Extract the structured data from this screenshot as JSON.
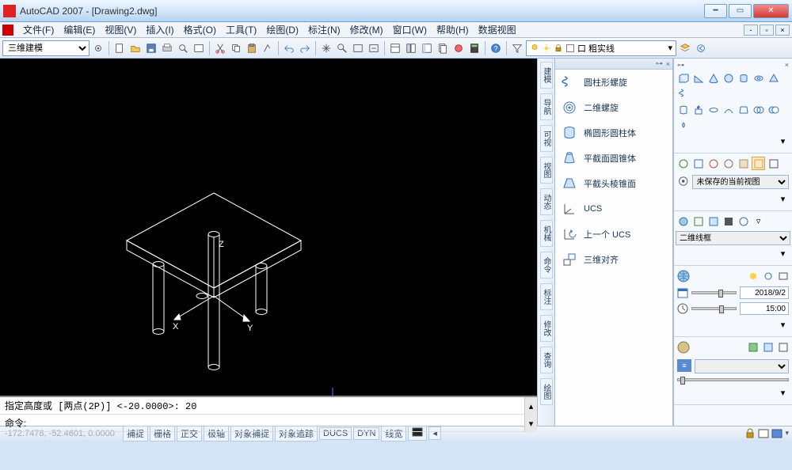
{
  "window": {
    "title": "AutoCAD 2007 - [Drawing2.dwg]"
  },
  "menu": {
    "items": [
      "文件(F)",
      "编辑(E)",
      "视图(V)",
      "插入(I)",
      "格式(O)",
      "工具(T)",
      "绘图(D)",
      "标注(N)",
      "修改(M)",
      "窗口(W)",
      "帮助(H)",
      "数据视图"
    ]
  },
  "toolbar": {
    "workspace_select": "三维建模",
    "layer_label": "口 粗实线"
  },
  "mid_panel": {
    "items": [
      {
        "icon": "spiral",
        "label": "圆柱形螺旋"
      },
      {
        "icon": "spiral2d",
        "label": "二维螺旋"
      },
      {
        "icon": "ellipsecyl",
        "label": "椭圆形圆柱体"
      },
      {
        "icon": "cone",
        "label": "平截面圆锥体"
      },
      {
        "icon": "pyramid",
        "label": "平截头棱锥面"
      },
      {
        "icon": "ucs",
        "label": "UCS"
      },
      {
        "icon": "ucsprev",
        "label": "上一个 UCS"
      },
      {
        "icon": "align3d",
        "label": "三维对齐"
      }
    ]
  },
  "vstrip": {
    "labels": [
      "建模",
      "导航",
      "可视",
      "视图",
      "动态",
      "机械",
      "命令",
      "标注",
      "修改",
      "查询",
      "绘图"
    ]
  },
  "right": {
    "view_saved": "未保存的当前视图",
    "wire_select": "二维线框",
    "date_value": "2018/9/2",
    "time_value": "15:00"
  },
  "command": {
    "history": "指定高度或 [两点(2P)] <-20.0000>: 20",
    "prompt": "命令:"
  },
  "status": {
    "coords": "-172.7478, -52.4601, 0.0000",
    "buttons": [
      "捕捉",
      "栅格",
      "正交",
      "极轴",
      "对象捕捉",
      "对象追踪",
      "DUCS",
      "DYN",
      "线宽"
    ]
  },
  "axes": {
    "x": "X",
    "y": "Y",
    "z": "Z"
  }
}
